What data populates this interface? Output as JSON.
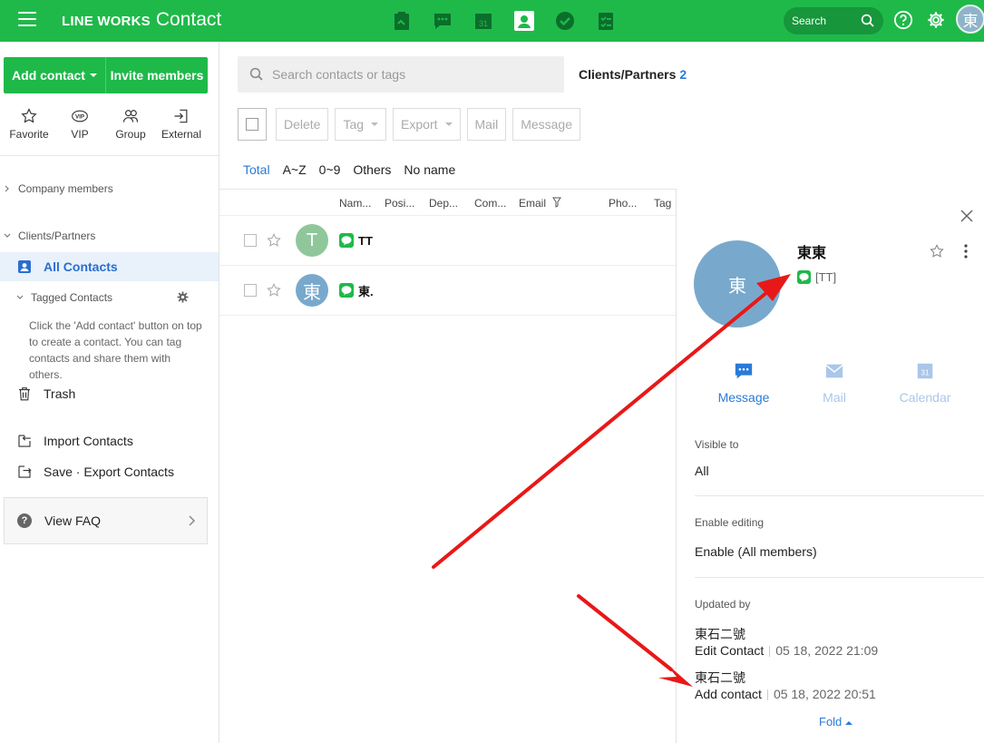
{
  "header": {
    "brand_bold": "LINE WORKS",
    "brand_light": "Contact",
    "search_label": "Search",
    "avatar_text": "東",
    "apps": [
      "note-icon",
      "chat-icon",
      "calendar-icon",
      "contact-icon",
      "task-icon",
      "form-icon"
    ],
    "calendar_day": "31"
  },
  "sidebar": {
    "add_contact": "Add contact",
    "invite_members": "Invite members",
    "quick": [
      {
        "label": "Favorite",
        "icon": "star-icon"
      },
      {
        "label": "VIP",
        "icon": "vip-icon"
      },
      {
        "label": "Group",
        "icon": "group-icon"
      },
      {
        "label": "External",
        "icon": "external-icon"
      }
    ],
    "company_members": "Company members",
    "clients_partners": "Clients/Partners",
    "all_contacts": "All Contacts",
    "tagged_contacts": "Tagged Contacts",
    "tag_help": "Click the 'Add contact' button on top to create a contact. You can tag contacts and share them with others.",
    "trash": "Trash",
    "import": "Import Contacts",
    "save_export": "Save · Export Contacts",
    "faq": "View FAQ"
  },
  "main": {
    "search_placeholder": "Search contacts or tags",
    "section_title": "Clients/Partners",
    "section_count": "2",
    "toolbar": {
      "delete": "Delete",
      "tag": "Tag",
      "export": "Export",
      "mail": "Mail",
      "message": "Message"
    },
    "filters": [
      "Total",
      "A~Z",
      "0~9",
      "Others",
      "No name"
    ],
    "columns": [
      "Nam...",
      "Posi...",
      "Dep...",
      "Com...",
      "Email",
      "Pho...",
      "Tag"
    ],
    "rows": [
      {
        "avatar": "T",
        "avatar_color": "#8fc79b",
        "name": "TT"
      },
      {
        "avatar": "東",
        "avatar_color": "#78a9cc",
        "name": "東."
      }
    ]
  },
  "detail": {
    "avatar": "東",
    "name": "東東",
    "line_tag": "[TT]",
    "actions": {
      "message": "Message",
      "mail": "Mail",
      "calendar": "Calendar"
    },
    "visible_to_label": "Visible to",
    "visible_to_value": "All",
    "enable_editing_label": "Enable editing",
    "enable_editing_value": "Enable (All members)",
    "updated_by_label": "Updated by",
    "updates": [
      {
        "user": "東石二號",
        "action": "Edit Contact",
        "date": "05 18, 2022 21:09"
      },
      {
        "user": "東石二號",
        "action": "Add contact",
        "date": "05 18, 2022 20:51"
      }
    ],
    "fold": "Fold"
  },
  "colors": {
    "brand": "#1fb94a",
    "accent_blue": "#2a7ad8",
    "arrow_red": "#e81818"
  }
}
